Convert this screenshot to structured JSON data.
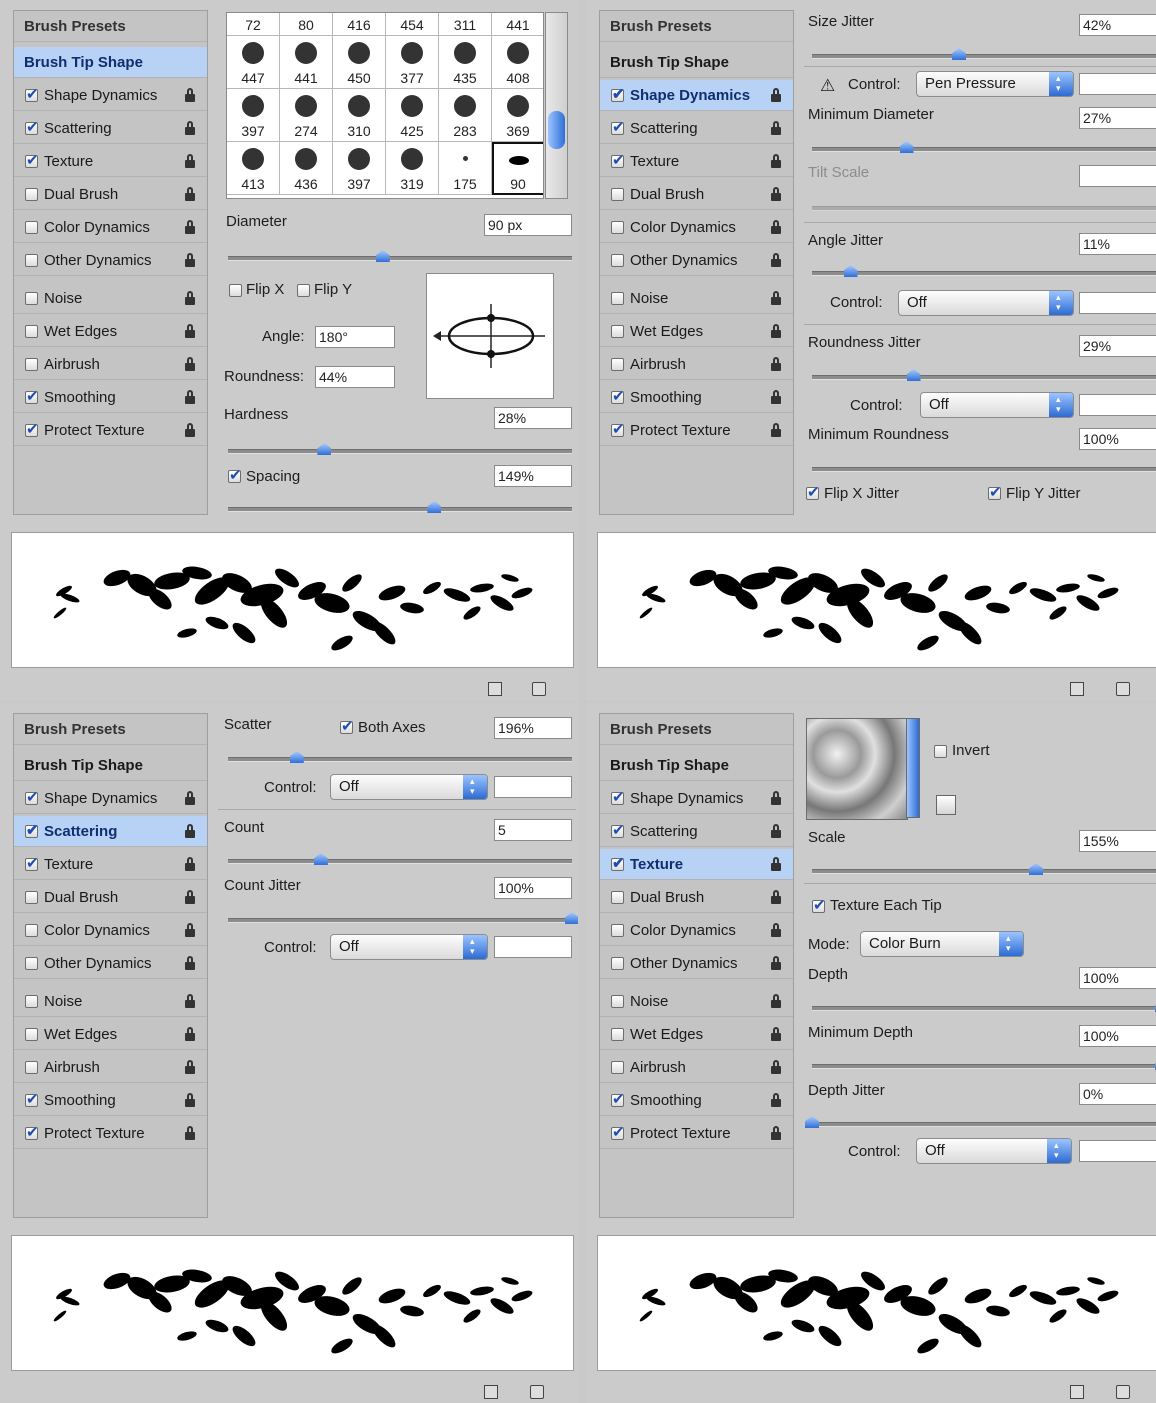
{
  "sidebar": {
    "header": "Brush Presets",
    "items": [
      {
        "label": "Brush Tip Shape",
        "checkable": false,
        "lock": false
      },
      {
        "label": "Shape Dynamics",
        "checkable": true,
        "lock": true
      },
      {
        "label": "Scattering",
        "checkable": true,
        "lock": true
      },
      {
        "label": "Texture",
        "checkable": true,
        "lock": true
      },
      {
        "label": "Dual Brush",
        "checkable": true,
        "lock": true
      },
      {
        "label": "Color Dynamics",
        "checkable": true,
        "lock": true
      },
      {
        "label": "Other Dynamics",
        "checkable": true,
        "lock": true
      },
      {
        "label": "Noise",
        "checkable": true,
        "lock": true
      },
      {
        "label": "Wet Edges",
        "checkable": true,
        "lock": true
      },
      {
        "label": "Airbrush",
        "checkable": true,
        "lock": true
      },
      {
        "label": "Smoothing",
        "checkable": true,
        "lock": true
      },
      {
        "label": "Protect Texture",
        "checkable": true,
        "lock": true
      }
    ],
    "checked": [
      "Shape Dynamics",
      "Scattering",
      "Texture",
      "Smoothing",
      "Protect Texture"
    ]
  },
  "panels": [
    {
      "selected": "Brush Tip Shape"
    },
    {
      "selected": "Shape Dynamics"
    },
    {
      "selected": "Scattering"
    },
    {
      "selected": "Texture"
    }
  ],
  "tip_shape": {
    "presets": [
      "72",
      "80",
      "416",
      "454",
      "311",
      "441",
      "447",
      "441",
      "450",
      "377",
      "435",
      "408",
      "397",
      "274",
      "310",
      "425",
      "283",
      "369",
      "413",
      "436",
      "397",
      "319",
      "175",
      "90"
    ],
    "selected_preset": "90",
    "diameter_label": "Diameter",
    "diameter_value": "90 px",
    "diameter_level": 0.45,
    "flip_x": "Flip X",
    "flip_y": "Flip Y",
    "angle_label": "Angle:",
    "angle_value": "180°",
    "roundness_label": "Roundness:",
    "roundness_value": "44%",
    "hardness_label": "Hardness",
    "hardness_value": "28%",
    "hardness_level": 0.28,
    "spacing_label": "Spacing",
    "spacing_value": "149%",
    "spacing_level": 0.6
  },
  "shape_dynamics": {
    "size_jitter_label": "Size Jitter",
    "size_jitter_value": "42%",
    "size_jitter_level": 0.42,
    "control_label": "Control:",
    "control_value": "Pen Pressure",
    "min_diameter_label": "Minimum Diameter",
    "min_diameter_value": "27%",
    "min_diameter_level": 0.27,
    "tilt_scale_label": "Tilt Scale",
    "angle_jitter_label": "Angle Jitter",
    "angle_jitter_value": "11%",
    "angle_jitter_level": 0.11,
    "angle_control_label": "Control:",
    "angle_control_value": "Off",
    "roundness_jitter_label": "Roundness Jitter",
    "roundness_jitter_value": "29%",
    "roundness_jitter_level": 0.29,
    "roundness_control_label": "Control:",
    "roundness_control_value": "Off",
    "min_roundness_label": "Minimum Roundness",
    "min_roundness_value": "100%",
    "flip_x_jitter": "Flip X Jitter",
    "flip_y_jitter": "Flip Y Jitter"
  },
  "scattering": {
    "scatter_label": "Scatter",
    "both_axes": "Both Axes",
    "scatter_value": "196%",
    "scatter_level": 0.2,
    "control_label": "Control:",
    "control_value": "Off",
    "count_label": "Count",
    "count_value": "5",
    "count_level": 0.27,
    "count_jitter_label": "Count Jitter",
    "count_jitter_value": "100%",
    "count_jitter_level": 1.0,
    "count_control_label": "Control:",
    "count_control_value": "Off"
  },
  "texture": {
    "invert": "Invert",
    "scale_label": "Scale",
    "scale_value": "155%",
    "scale_level": 0.64,
    "each_tip": "Texture Each Tip",
    "mode_label": "Mode:",
    "mode_value": "Color Burn",
    "depth_label": "Depth",
    "depth_value": "100%",
    "depth_level": 1.0,
    "min_depth_label": "Minimum Depth",
    "min_depth_value": "100%",
    "min_depth_level": 1.0,
    "depth_jitter_label": "Depth Jitter",
    "depth_jitter_value": "0%",
    "depth_jitter_level": 0.0,
    "control_label": "Control:",
    "control_value": "Off"
  },
  "colors": {
    "selection": "#b7d2f4",
    "accent": "#2f6fd6",
    "panel": "#cbcbcb"
  }
}
